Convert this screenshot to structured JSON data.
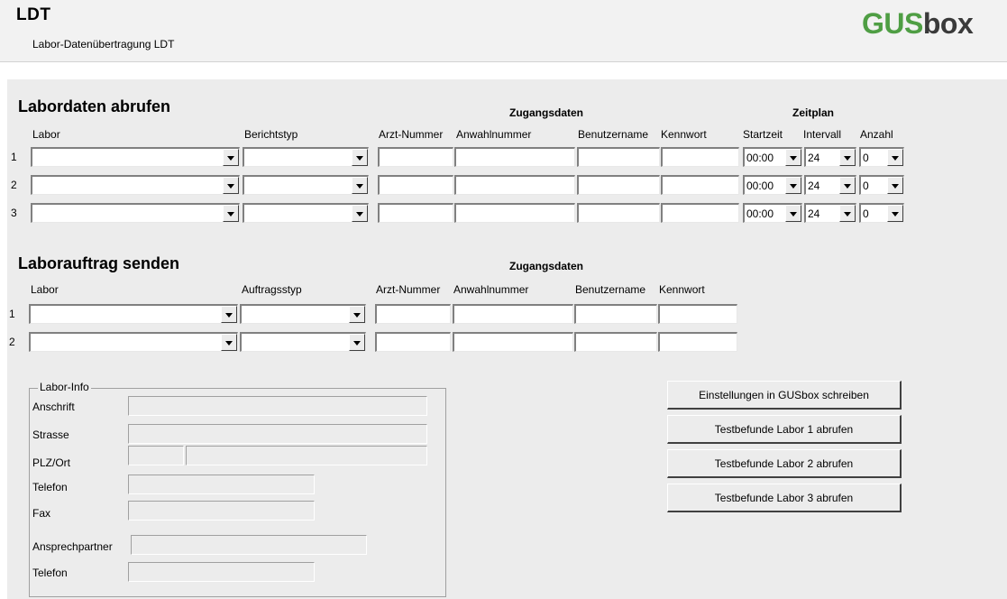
{
  "header": {
    "app_title": "LDT",
    "app_subtitle": "Labor-Datenübertragung LDT",
    "logo_part1": "GUS",
    "logo_part2": "box"
  },
  "colors": {
    "logo_green": "#4f9e44",
    "panel_bg": "#ececec"
  },
  "abrufen": {
    "title": "Labordaten abrufen",
    "group_zugang": "Zugangsdaten",
    "group_zeitplan": "Zeitplan",
    "columns": {
      "labor": "Labor",
      "berichtstyp": "Berichtstyp",
      "arzt_nummer": "Arzt-Nummer",
      "anwahlnummer": "Anwahlnummer",
      "benutzername": "Benutzername",
      "kennwort": "Kennwort",
      "startzeit": "Startzeit",
      "intervall": "Intervall",
      "anzahl": "Anzahl"
    },
    "rows": [
      {
        "num": "1",
        "labor": "",
        "berichtstyp": "",
        "arzt_nummer": "",
        "anwahlnummer": "",
        "benutzername": "",
        "kennwort": "",
        "startzeit": "00:00",
        "intervall": "24",
        "anzahl": "0"
      },
      {
        "num": "2",
        "labor": "",
        "berichtstyp": "",
        "arzt_nummer": "",
        "anwahlnummer": "",
        "benutzername": "",
        "kennwort": "",
        "startzeit": "00:00",
        "intervall": "24",
        "anzahl": "0"
      },
      {
        "num": "3",
        "labor": "",
        "berichtstyp": "",
        "arzt_nummer": "",
        "anwahlnummer": "",
        "benutzername": "",
        "kennwort": "",
        "startzeit": "00:00",
        "intervall": "24",
        "anzahl": "0"
      }
    ]
  },
  "senden": {
    "title": "Laborauftrag senden",
    "group_zugang": "Zugangsdaten",
    "columns": {
      "labor": "Labor",
      "auftragstyp": "Auftragsstyp",
      "arzt_nummer": "Arzt-Nummer",
      "anwahlnummer": "Anwahlnummer",
      "benutzername": "Benutzername",
      "kennwort": "Kennwort"
    },
    "rows": [
      {
        "num": "1",
        "labor": "",
        "auftragstyp": "",
        "arzt_nummer": "",
        "anwahlnummer": "",
        "benutzername": "",
        "kennwort": ""
      },
      {
        "num": "2",
        "labor": "",
        "auftragstyp": "",
        "arzt_nummer": "",
        "anwahlnummer": "",
        "benutzername": "",
        "kennwort": ""
      }
    ]
  },
  "labor_info": {
    "legend": "Labor-Info",
    "anschrift": "Anschrift",
    "strasse": "Strasse",
    "plz_ort": "PLZ/Ort",
    "telefon": "Telefon",
    "fax": "Fax",
    "ansprechpartner": "Ansprechpartner",
    "telefon2": "Telefon"
  },
  "actions": {
    "write_settings": "Einstellungen in GUSbox schreiben",
    "test1": "Testbefunde Labor 1 abrufen",
    "test2": "Testbefunde Labor 2 abrufen",
    "test3": "Testbefunde Labor 3 abrufen"
  }
}
